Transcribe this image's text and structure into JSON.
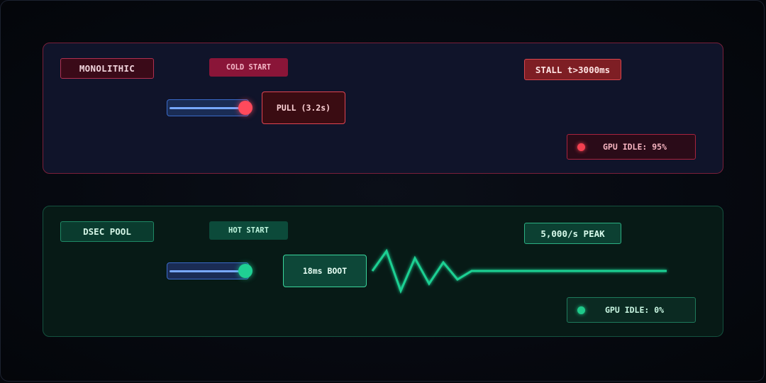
{
  "monolithic": {
    "label": "MONOLITHIC",
    "badge": "COLD START",
    "stall": "STALL t>3000ms",
    "pull": "PULL (3.2s)",
    "gpu_idle": "GPU IDLE: 95%",
    "progress": 1.0
  },
  "dsec": {
    "label": "DSEC POOL",
    "badge": "HOT START",
    "peak": "5,000/s PEAK",
    "boot": "18ms BOOT",
    "gpu_idle": "GPU IDLE: 0%",
    "progress": 1.0
  },
  "colors": {
    "red_accent": "#ff4a5c",
    "green_accent": "#1fd093",
    "track_blue": "#78a8ff"
  }
}
